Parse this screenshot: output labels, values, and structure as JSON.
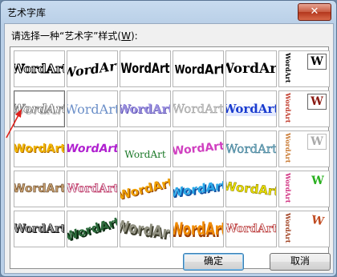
{
  "window": {
    "title": "艺术字库",
    "close_glyph": "✕"
  },
  "prompt": {
    "text_before": "请选择一种“艺术字”样式(",
    "hotkey": "W",
    "text_after": "):"
  },
  "gallery": {
    "sample_text": "WordArt",
    "vertical_text": "WordArt",
    "w_glyph": "W",
    "selected": {
      "row": 1,
      "col": 0
    }
  },
  "buttons": {
    "ok": "确定",
    "cancel": "取消"
  },
  "colors": {
    "accent_arrow": "#e0201a",
    "selection_border": "#6a6a6a"
  }
}
